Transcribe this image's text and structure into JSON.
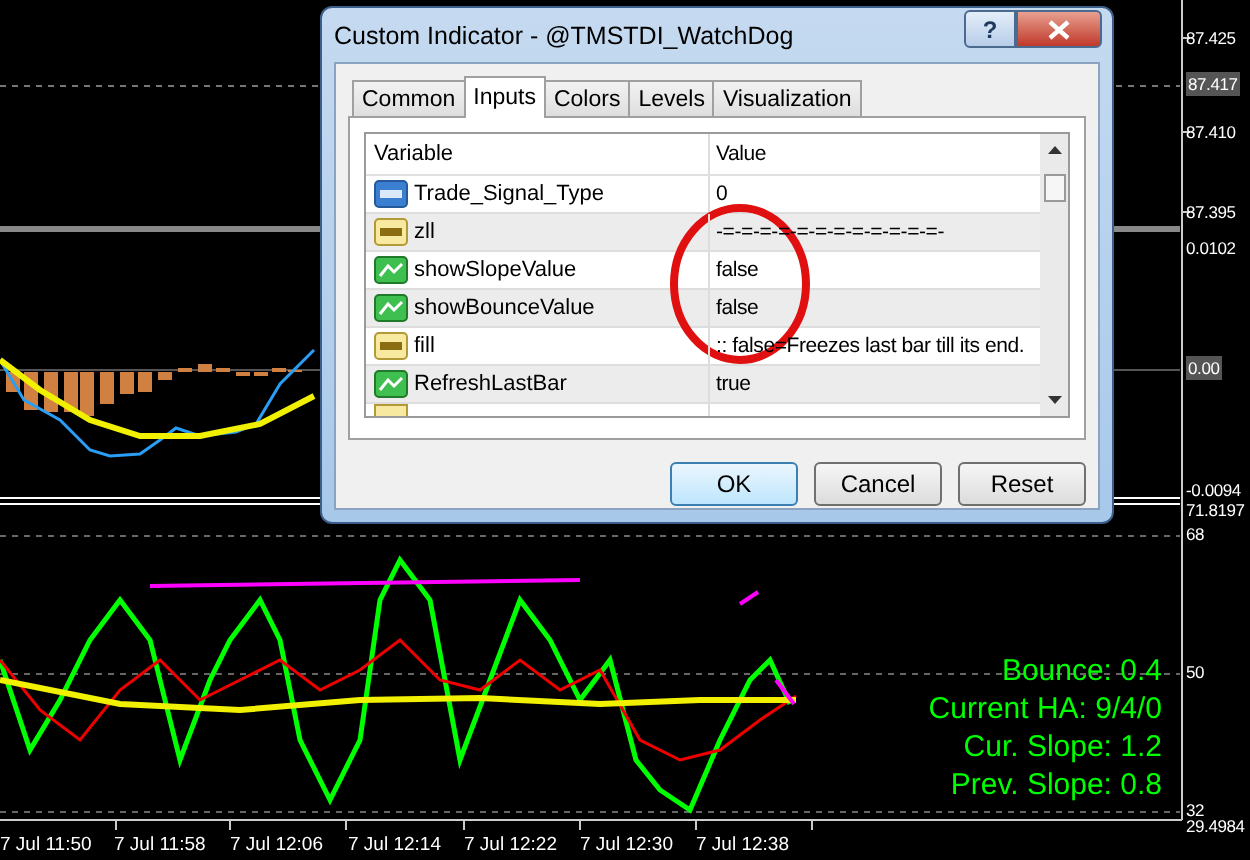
{
  "price_axis": {
    "labels": [
      "87.425",
      "87.410",
      "87.395"
    ],
    "current_price": "87.417"
  },
  "indicator_axis": {
    "labels": [
      "0.0102",
      "-0.0094"
    ],
    "zero_label": "0.00"
  },
  "oscillator_axis": {
    "labels": [
      "71.8197",
      "68",
      "50",
      "32",
      "29.4984"
    ]
  },
  "time_axis": [
    "7 Jul 11:50",
    "7 Jul 11:58",
    "7 Jul 12:06",
    "7 Jul 12:14",
    "7 Jul 12:22",
    "7 Jul 12:30",
    "7 Jul 12:38"
  ],
  "info_panel": [
    "Bounce: 0.4",
    "Current HA: 9/4/0",
    "Cur. Slope: 1.2",
    "Prev. Slope: 0.8"
  ],
  "dialog": {
    "title": "Custom Indicator - @TMSTDI_WatchDog",
    "help": "?",
    "tabs": [
      {
        "label": "Common",
        "selected": false
      },
      {
        "label": "Inputs",
        "selected": true
      },
      {
        "label": "Colors",
        "selected": false
      },
      {
        "label": "Levels",
        "selected": false
      },
      {
        "label": "Visualization",
        "selected": false
      }
    ],
    "columns": [
      "Variable",
      "Value"
    ],
    "rows": [
      {
        "kind": "number",
        "variable": "Trade_Signal_Type",
        "value": "0"
      },
      {
        "kind": "string",
        "variable": "zll",
        "value": "-=-=-=-=-=-=-=-=-=-=-=-=-"
      },
      {
        "kind": "bool",
        "variable": "showSlopeValue",
        "value": "false"
      },
      {
        "kind": "bool",
        "variable": "showBounceValue",
        "value": "false"
      },
      {
        "kind": "string",
        "variable": "fill",
        "value": ":: false=Freezes last bar till its end."
      },
      {
        "kind": "bool",
        "variable": "RefreshLastBar",
        "value": "true"
      }
    ],
    "buttons": [
      {
        "label": "OK",
        "default": true
      },
      {
        "label": "Cancel",
        "default": false
      },
      {
        "label": "Reset",
        "default": false
      }
    ]
  }
}
